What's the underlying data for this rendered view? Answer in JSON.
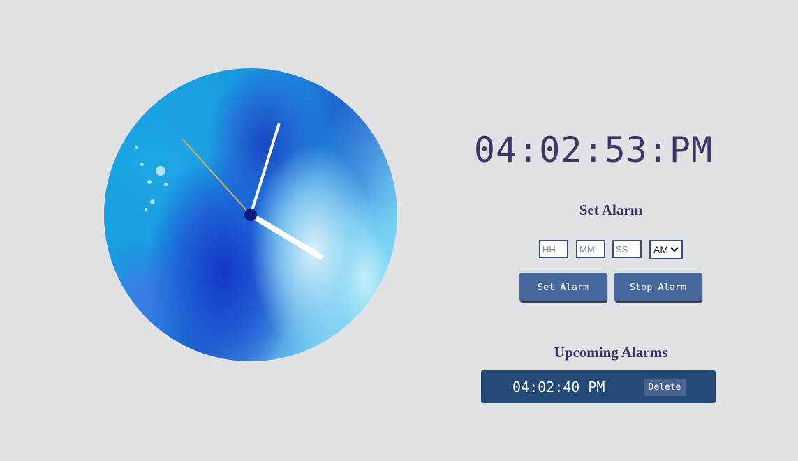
{
  "clock": {
    "face": "watercolor-blue-clock-face",
    "time": {
      "hours": 4,
      "minutes": 2,
      "seconds": 53
    },
    "colors": {
      "hands": "#ffffff",
      "second_hand": "#c9b55a",
      "center": "#0b1b84"
    }
  },
  "digital_time": "04:02:53:PM",
  "set_alarm": {
    "heading": "Set Alarm",
    "hh_placeholder": "HH",
    "mm_placeholder": "MM",
    "ss_placeholder": "SS",
    "ampm_value": "AM",
    "set_button": "Set Alarm",
    "stop_button": "Stop Alarm"
  },
  "upcoming": {
    "heading": "Upcoming Alarms",
    "alarms": [
      {
        "time": "04:02:40 PM",
        "delete_label": "Delete"
      }
    ]
  },
  "colors": {
    "background": "#e0e2e4",
    "button": "#45679a",
    "alarm_row": "#244b77",
    "text": "#3b3766"
  }
}
